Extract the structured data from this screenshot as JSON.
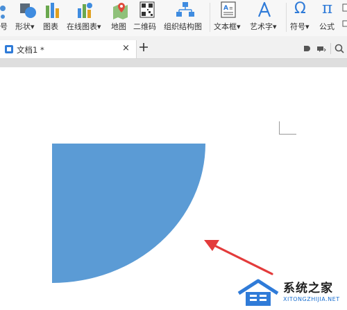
{
  "toolbar": {
    "items": [
      {
        "label": "号",
        "icon": "partial-icon"
      },
      {
        "label": "形状",
        "icon": "shapes-icon"
      },
      {
        "label": "图表",
        "icon": "chart-icon"
      },
      {
        "label": "在线图表",
        "icon": "online-chart-icon"
      },
      {
        "label": "地图",
        "icon": "map-icon"
      },
      {
        "label": "二维码",
        "icon": "qr-code-icon"
      },
      {
        "label": "组织结构图",
        "icon": "org-chart-icon"
      },
      {
        "label": "文本框",
        "icon": "text-box-icon"
      },
      {
        "label": "艺术字",
        "icon": "word-art-icon"
      },
      {
        "label": "符号",
        "icon": "omega-icon"
      },
      {
        "label": "公式",
        "icon": "pi-icon"
      }
    ],
    "omega_glyph": "Ω",
    "pi_glyph": "π",
    "dropdown_glyph": "▾"
  },
  "tabs": {
    "document_name": "文档1 *",
    "close_glyph": "×"
  },
  "watermark": {
    "main_text": "系统之家",
    "sub_text": "XITONGZHIJIA.NET"
  },
  "colors": {
    "shape_fill": "#5b9bd5",
    "arrow": "#e33b3b",
    "accent_blue": "#2f7bd8"
  }
}
